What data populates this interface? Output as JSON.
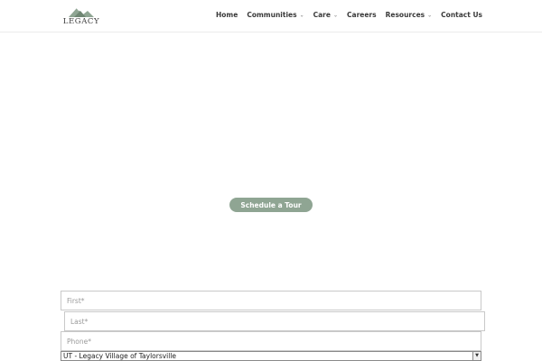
{
  "brand": {
    "logo_text": "LEGACY",
    "accent": "#8fa593"
  },
  "nav": {
    "items": [
      {
        "label": "Home",
        "has_dropdown": false
      },
      {
        "label": "Communities",
        "has_dropdown": true
      },
      {
        "label": "Care",
        "has_dropdown": true
      },
      {
        "label": "Careers",
        "has_dropdown": false
      },
      {
        "label": "Resources",
        "has_dropdown": true
      },
      {
        "label": "Contact Us",
        "has_dropdown": false
      }
    ],
    "dropdown_icon": "chevron-down-icon"
  },
  "hero": {
    "cta_label": "Schedule a Tour"
  },
  "form": {
    "first_placeholder": "First*",
    "last_placeholder": "Last*",
    "phone_placeholder": "Phone*",
    "community_selected": "UT - Legacy Village of Taylorsville"
  }
}
